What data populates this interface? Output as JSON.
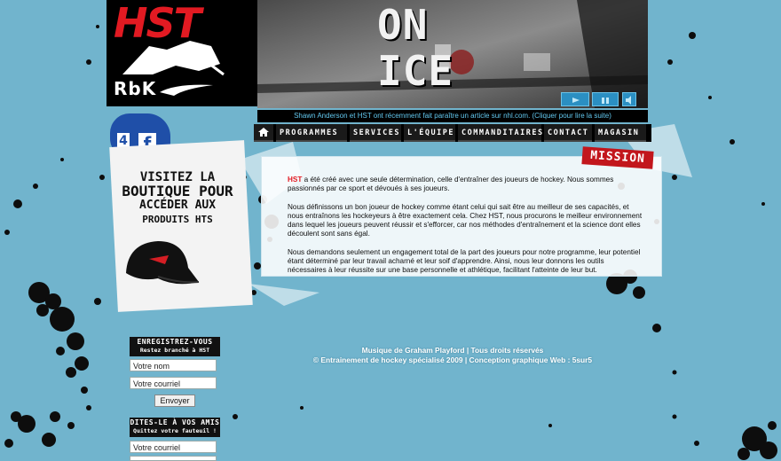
{
  "brand": {
    "logo_text": "HST",
    "sponsor_text": "RbK"
  },
  "video": {
    "title": "ON ICE",
    "controls": [
      "rewind-icon",
      "pause-icon",
      "volume-icon"
    ]
  },
  "news_ticker": "Shawn Anderson et HST ont récemment fait paraître un article sur nhl.com. (Cliquer pour lire la suite)",
  "nav": {
    "home_icon": "home-icon",
    "items": [
      "Programmes",
      "Services",
      "L'équipe",
      "Commanditaires",
      "Contact",
      "Magasin"
    ]
  },
  "mission": {
    "badge": "MISSION",
    "p1_brand": "HST",
    "p1_rest": " a été créé avec une seule détermination, celle d'entraîner des joueurs de hockey. Nous sommes passionnés par ce sport et dévoués à ses joueurs.",
    "p2": "Nous définissons un bon joueur de hockey comme étant celui qui sait être au meilleur de ses capacités, et nous entraînons les hockeyeurs à être exactement cela. Chez HST, nous procurons le meilleur environnement dans lequel les joueurs peuvent réussir et s'efforcer, car nos méthodes d'entraînement et la science dont elles découlent sont sans égal.",
    "p3": "Nous demandons seulement un engagement total de la part des joueurs pour notre programme, leur potentiel étant déterminé par leur travail acharné et leur soif d'apprendre. Ainsi, nous leur donnons les outils nécessaires à leur réussite sur une base personnelle et athlétique, facilitant l'atteinte de leur but."
  },
  "shop": {
    "line1": "VISITEZ LA",
    "line2": "BOUTIQUE POUR",
    "line3": "ACCÉDER AUX",
    "line4": "PRODUITS HTS"
  },
  "register": {
    "title": "ENREGISTREZ-VOUS",
    "subtitle": "Restez branché à HST",
    "name_placeholder": "Votre nom",
    "email_placeholder": "Votre courriel",
    "submit": "Envoyer"
  },
  "tell_friends": {
    "title": "DITES-LE À VOS AMIS",
    "subtitle": "Quittez votre fauteuil !",
    "email_placeholder": "Votre courriel"
  },
  "footer": {
    "line1": "Musique de Graham Playford | Tous droits réservés",
    "line2": "© Entrainement de hockey spécialisé 2009 | Conception graphique Web : 5sur5"
  },
  "colors": {
    "background": "#5fa9c4",
    "accent": "#e21a22",
    "ticker_text": "#62c7ee",
    "control_blue": "#2b8fc2"
  }
}
